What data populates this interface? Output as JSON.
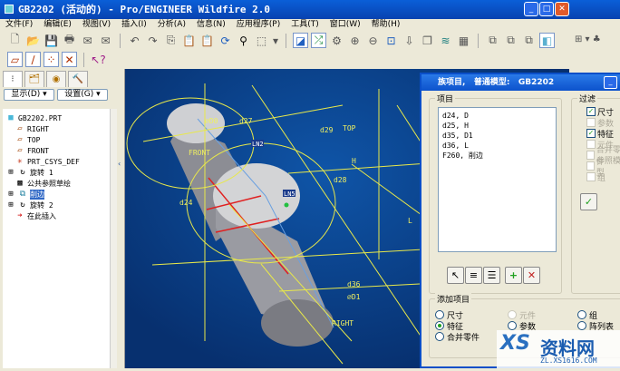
{
  "window": {
    "title": "GB2202 (活动的) - Pro/ENGINEER Wildfire 2.0"
  },
  "menu": [
    "文件(F)",
    "编辑(E)",
    "视图(V)",
    "插入(I)",
    "分析(A)",
    "信息(N)",
    "应用程序(P)",
    "工具(T)",
    "窗口(W)",
    "帮助(H)"
  ],
  "left_panel": {
    "show_button": "显示(D) ▾",
    "settings_button": "设置(G) ▾",
    "tree": [
      {
        "label": "GB2202.PRT",
        "icon": "part-icon"
      },
      {
        "label": "RIGHT",
        "icon": "datum-plane-icon"
      },
      {
        "label": "TOP",
        "icon": "datum-plane-icon"
      },
      {
        "label": "FRONT",
        "icon": "datum-plane-icon"
      },
      {
        "label": "PRT_CSYS_DEF",
        "icon": "csys-icon"
      },
      {
        "label": "旋转 1",
        "icon": "revolve-icon"
      },
      {
        "label": "公共参照草绘",
        "icon": "sketch-icon"
      },
      {
        "label": "削边",
        "icon": "cut-icon",
        "selected": true
      },
      {
        "label": "旋转 2",
        "icon": "revolve-icon"
      },
      {
        "label": "在此插入",
        "icon": "insert-arrow-icon"
      }
    ]
  },
  "model_labels": {
    "d0": "⌀D0",
    "d27": "d27",
    "d29": "d29",
    "top": "TOP",
    "front": "FRONT",
    "d24": "d24",
    "h": "H",
    "d28": "d28",
    "l": "L",
    "d36": "d36",
    "d1": "⌀D1",
    "right": "RIGHT",
    "ln2": "LN2",
    "ln5": "LN5"
  },
  "dialog": {
    "title": "族项目,   普通模型:   GB2202",
    "items_label": "项目",
    "items": [
      "d24, D",
      "d25, H",
      "d35, D1",
      "d36, L",
      "F260, 削边"
    ],
    "filter_label": "过滤",
    "filters": [
      {
        "label": "尺寸",
        "checked": true,
        "enabled": true
      },
      {
        "label": "参数",
        "checked": false,
        "enabled": false
      },
      {
        "label": "特征",
        "checked": true,
        "enabled": true
      },
      {
        "label": "元件",
        "checked": false,
        "enabled": false
      },
      {
        "label": "合并零件",
        "checked": false,
        "enabled": false
      },
      {
        "label": "参照模型",
        "checked": false,
        "enabled": false
      },
      {
        "label": "组",
        "checked": false,
        "enabled": false
      }
    ],
    "add_label": "添加项目",
    "add_options": [
      {
        "label": "尺寸",
        "selected": false,
        "enabled": true
      },
      {
        "label": "特征",
        "selected": true,
        "enabled": true
      },
      {
        "label": "合并零件",
        "selected": false,
        "enabled": true
      },
      {
        "label": "元件",
        "selected": false,
        "enabled": false
      },
      {
        "label": "参数",
        "selected": false,
        "enabled": true
      },
      {
        "label": "组",
        "selected": false,
        "enabled": true
      },
      {
        "label": "阵列表",
        "selected": false,
        "enabled": true
      }
    ]
  },
  "watermark": {
    "text": "资料网",
    "url": "ZL.XS1616.COM"
  }
}
